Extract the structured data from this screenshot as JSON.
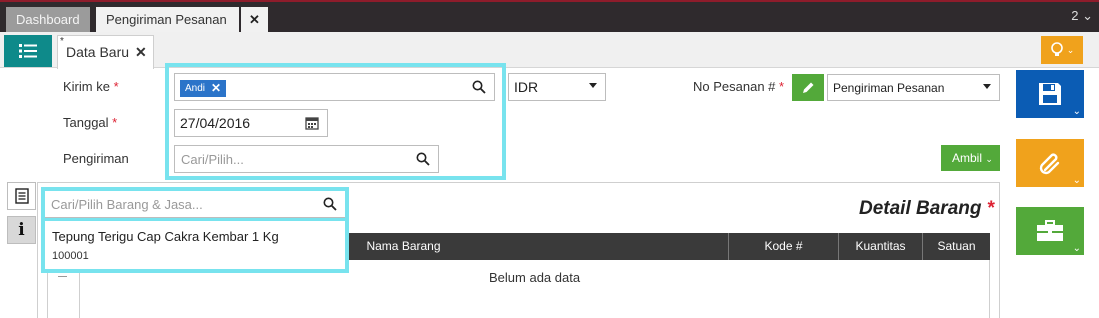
{
  "topbar": {
    "tab_dashboard": "Dashboard",
    "tab_active": "Pengiriman Pesanan",
    "tab_close": "✕",
    "counter": "2"
  },
  "subbar": {
    "form_tab_label": "Data Baru",
    "form_tab_close": "✕",
    "form_tab_marker": "*"
  },
  "form": {
    "kirim_ke_label": "Kirim ke",
    "kirim_ke_tag": "Andi",
    "currency": "IDR",
    "no_pesanan_label": "No Pesanan #",
    "no_pesanan_value": "Pengiriman Pesanan",
    "tanggal_label": "Tanggal",
    "tanggal_value": "27/04/2016",
    "pengiriman_label": "Pengiriman",
    "pengiriman_placeholder": "Cari/Pilih...",
    "ambil_label": "Ambil",
    "required_mark": "*"
  },
  "detail": {
    "search_placeholder": "Cari/Pilih Barang & Jasa...",
    "title": "Detail Barang",
    "title_mark": "*",
    "columns": [
      "Nama Barang",
      "Kode #",
      "Kuantitas",
      "Satuan"
    ],
    "empty_text": "Belum ada data",
    "suggestion": {
      "name": "Tepung Terigu Cap Cakra Kembar 1 Kg",
      "code": "100001"
    }
  },
  "colors": {
    "teal": "#0e8a8a",
    "orange": "#f0a21c",
    "blue": "#0b5cb4",
    "green": "#53a93a",
    "highlight": "#78e3ee",
    "tag": "#2b74c9"
  },
  "icons": [
    "list-icon",
    "lightbulb-icon",
    "search-icon",
    "calendar-icon",
    "pencil-icon",
    "save-icon",
    "paperclip-icon",
    "briefcase-icon",
    "document-icon",
    "info-icon"
  ]
}
